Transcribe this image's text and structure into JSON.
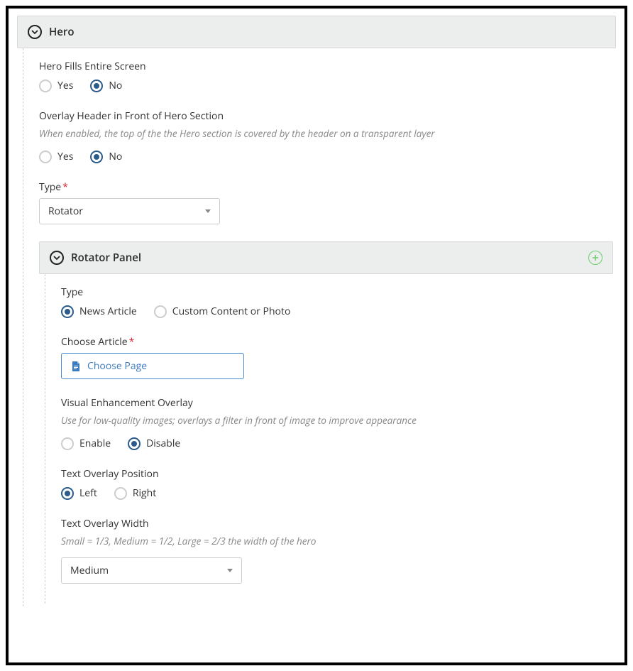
{
  "hero": {
    "title": "Hero",
    "fills": {
      "label": "Hero Fills Entire Screen",
      "yes": "Yes",
      "no": "No",
      "selected": "No"
    },
    "overlay": {
      "label": "Overlay Header in Front of Hero Section",
      "desc": "When enabled, the top of the the Hero section is covered by the header on a transparent layer",
      "yes": "Yes",
      "no": "No",
      "selected": "No"
    },
    "type": {
      "label": "Type",
      "value": "Rotator"
    }
  },
  "rotator": {
    "title": "Rotator Panel",
    "type": {
      "label": "Type",
      "opt1": "News Article",
      "opt2": "Custom Content or Photo",
      "selected": "News Article"
    },
    "article": {
      "label": "Choose Article",
      "button": "Choose Page"
    },
    "enhancement": {
      "label": "Visual Enhancement Overlay",
      "desc": "Use for low-quality images; overlays a filter in front of image to improve appearance",
      "enable": "Enable",
      "disable": "Disable",
      "selected": "Disable"
    },
    "position": {
      "label": "Text Overlay Position",
      "left": "Left",
      "right": "Right",
      "selected": "Left"
    },
    "width": {
      "label": "Text Overlay Width",
      "desc": "Small = 1/3, Medium = 1/2, Large = 2/3 the width of the hero",
      "value": "Medium"
    }
  }
}
